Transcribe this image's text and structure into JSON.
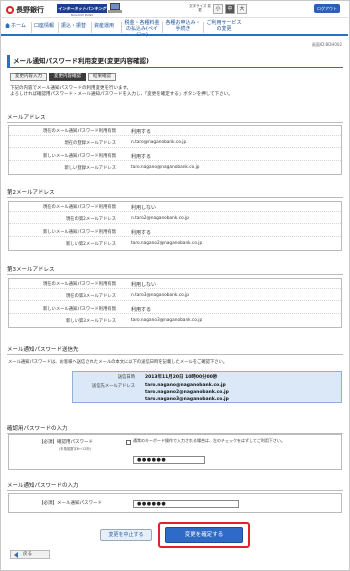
{
  "header": {
    "bank_name": "長野銀行",
    "banner": "インターネットバンキング",
    "banner_sub": "NAGANO BANK",
    "font_size_label": "文字サイズ 変更",
    "font_sizes": [
      "小",
      "中",
      "大"
    ],
    "logout": "ログアウト"
  },
  "nav": {
    "home": "ホーム",
    "items": [
      "口座情報",
      "振込・振替",
      "資産運用",
      "税金・各種料金の払込み(ペイジー)",
      "各種お申込み・手続き",
      "ご利用サービスの変更"
    ]
  },
  "screen_id": "画面ID:BDH002",
  "title": "メール通知パスワード利用変更(変更内容確認)",
  "steps": [
    "変更内容入力",
    "変更内容確認",
    "結果確認"
  ],
  "intro": [
    "下記の内容でメール通知パスワードの利用変更を行います。",
    "よろしければ確認用パスワード・メール通知パスワードを入力し、「変更を確定する」ボタンを押して下さい。"
  ],
  "sections": {
    "mail1": {
      "title": "メールアドレス",
      "rows": [
        {
          "label": "現在のメール通知パスワード利用有無",
          "value": "利用する"
        },
        {
          "label": "現在の登録メールアドレス",
          "value": "n.taro@naganobank.co.jp"
        },
        {
          "label": "新しいメール通知パスワード利用有無",
          "value": "利用する"
        },
        {
          "label": "新しい登録メールアドレス",
          "value": "taro.nagano@naganobank.co.jp"
        }
      ]
    },
    "mail2": {
      "title": "第2メールアドレス",
      "rows": [
        {
          "label": "現在のメール通知パスワード利用有無",
          "value": "利用しない"
        },
        {
          "label": "現在の第2メールアドレス",
          "value": "n.taro2@naganobank.co.jp"
        },
        {
          "label": "新しいメール通知パスワード利用有無",
          "value": "利用する"
        },
        {
          "label": "新しい第2メールアドレス",
          "value": "taro.nagano2@naganobank.co.jp"
        }
      ]
    },
    "mail3": {
      "title": "第3メールアドレス",
      "rows": [
        {
          "label": "現在のメール通知パスワード利用有無",
          "value": "利用しない"
        },
        {
          "label": "現在の第3メールアドレス",
          "value": "n.taro3@naganobank.co.jp"
        },
        {
          "label": "新しいメール通知パスワード利用有無",
          "value": "利用する"
        },
        {
          "label": "新しい第3メールアドレス",
          "value": "taro.nagano3@naganobank.co.jp"
        }
      ]
    }
  },
  "notice": {
    "title": "メール通知パスワード送信先",
    "text": "メール通知パスワードは、お客様へ送信されたメールの本文に以下の送信日時を記載したメールをご確認下さい。",
    "sent_label": "送信日時",
    "sent_value": "2013年11月20日 10時00分00秒",
    "addr_label": "送信先メールアドレス",
    "addresses": [
      "taro.nagano@naganobank.co.jp",
      "taro.nagano2@naganobank.co.jp",
      "taro.nagano3@naganobank.co.jp"
    ]
  },
  "confirm_pw": {
    "title": "確認用パスワードの入力",
    "required": "【必須】",
    "label": "確認用パスワード",
    "sub": "(半角英数字6〜12桁)",
    "checkbox_text": "通常のキーボード操作で入力される場合は、左のチェックをはずしてご利用下さい。",
    "value": "●●●●●●"
  },
  "mail_pw": {
    "title": "メール通知パスワードの入力",
    "required": "【必須】",
    "label": "メール通知パスワード",
    "value": "●●●●●●"
  },
  "buttons": {
    "cancel": "変更を中止する",
    "confirm": "変更を確定する",
    "back": "戻る"
  }
}
